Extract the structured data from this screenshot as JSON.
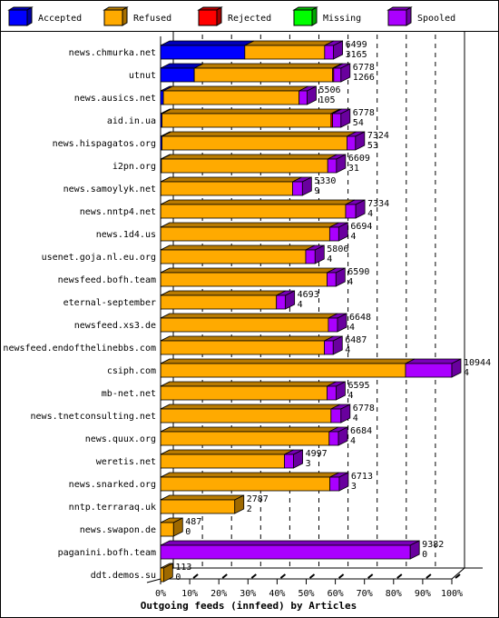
{
  "chart_data": {
    "type": "bar",
    "orientation": "horizontal",
    "stacked": true,
    "three_d": true,
    "title": "Outgoing feeds (innfeed) by Articles",
    "xlabel": "Outgoing feeds (innfeed) by Articles",
    "ylabel": "",
    "xlim": [
      0,
      100
    ],
    "x_unit": "%",
    "x_ticks": [
      "0%",
      "10%",
      "20%",
      "30%",
      "40%",
      "50%",
      "60%",
      "70%",
      "80%",
      "90%",
      "100%"
    ],
    "scale_max": 10944,
    "grid": true,
    "legend_position": "top",
    "legend": [
      {
        "name": "Accepted",
        "color": "#0000ff"
      },
      {
        "name": "Refused",
        "color": "#ffaa00"
      },
      {
        "name": "Rejected",
        "color": "#ff0000"
      },
      {
        "name": "Missing",
        "color": "#00ff00"
      },
      {
        "name": "Spooled",
        "color": "#aa00ff"
      }
    ],
    "categories": [
      "news.chmurka.net",
      "utnut",
      "news.ausics.net",
      "aid.in.ua",
      "news.hispagatos.org",
      "i2pn.org",
      "news.samoylyk.net",
      "news.nntp4.net",
      "news.1d4.us",
      "usenet.goja.nl.eu.org",
      "newsfeed.bofh.team",
      "eternal-september",
      "newsfeed.xs3.de",
      "newsfeed.endofthelinebbs.com",
      "csiph.com",
      "mb-net.net",
      "news.tnetconsulting.net",
      "news.quux.org",
      "weretis.net",
      "news.snarked.org",
      "nntp.terraraq.uk",
      "news.swapon.de",
      "paganini.bofh.team",
      "ddt.demos.su"
    ],
    "totals": [
      6499,
      6778,
      5506,
      6778,
      7324,
      6609,
      5330,
      7334,
      6694,
      5806,
      6590,
      4693,
      6648,
      6487,
      10944,
      6595,
      6778,
      6684,
      4997,
      6713,
      2787,
      487,
      9382,
      113
    ],
    "accepted_labels": [
      3165,
      1266,
      105,
      54,
      53,
      31,
      9,
      4,
      4,
      4,
      4,
      4,
      4,
      4,
      4,
      4,
      4,
      4,
      3,
      3,
      2,
      0,
      0,
      0
    ],
    "series": [
      {
        "name": "Accepted",
        "values": [
          3165,
          1266,
          105,
          54,
          53,
          31,
          9,
          4,
          4,
          4,
          4,
          4,
          4,
          4,
          4,
          4,
          4,
          4,
          3,
          3,
          2,
          0,
          0,
          0
        ]
      },
      {
        "name": "Refused",
        "values": [
          3000,
          5200,
          5100,
          6350,
          6950,
          6250,
          4950,
          6950,
          6350,
          5450,
          6250,
          4350,
          6300,
          6150,
          9200,
          6250,
          6400,
          6330,
          4650,
          6360,
          2785,
          487,
          0,
          113
        ]
      },
      {
        "name": "Rejected",
        "values": [
          0,
          40,
          0,
          60,
          0,
          0,
          0,
          0,
          0,
          0,
          0,
          0,
          0,
          0,
          0,
          0,
          0,
          0,
          0,
          0,
          0,
          0,
          0,
          0
        ]
      },
      {
        "name": "Missing",
        "values": [
          0,
          0,
          0,
          0,
          0,
          0,
          0,
          0,
          0,
          0,
          0,
          0,
          0,
          0,
          0,
          0,
          0,
          0,
          0,
          0,
          0,
          0,
          0,
          0
        ]
      },
      {
        "name": "Spooled",
        "values": [
          334,
          272,
          301,
          314,
          321,
          328,
          371,
          380,
          340,
          352,
          336,
          339,
          344,
          333,
          1740,
          341,
          374,
          350,
          344,
          350,
          0,
          0,
          9382,
          0
        ]
      }
    ]
  }
}
